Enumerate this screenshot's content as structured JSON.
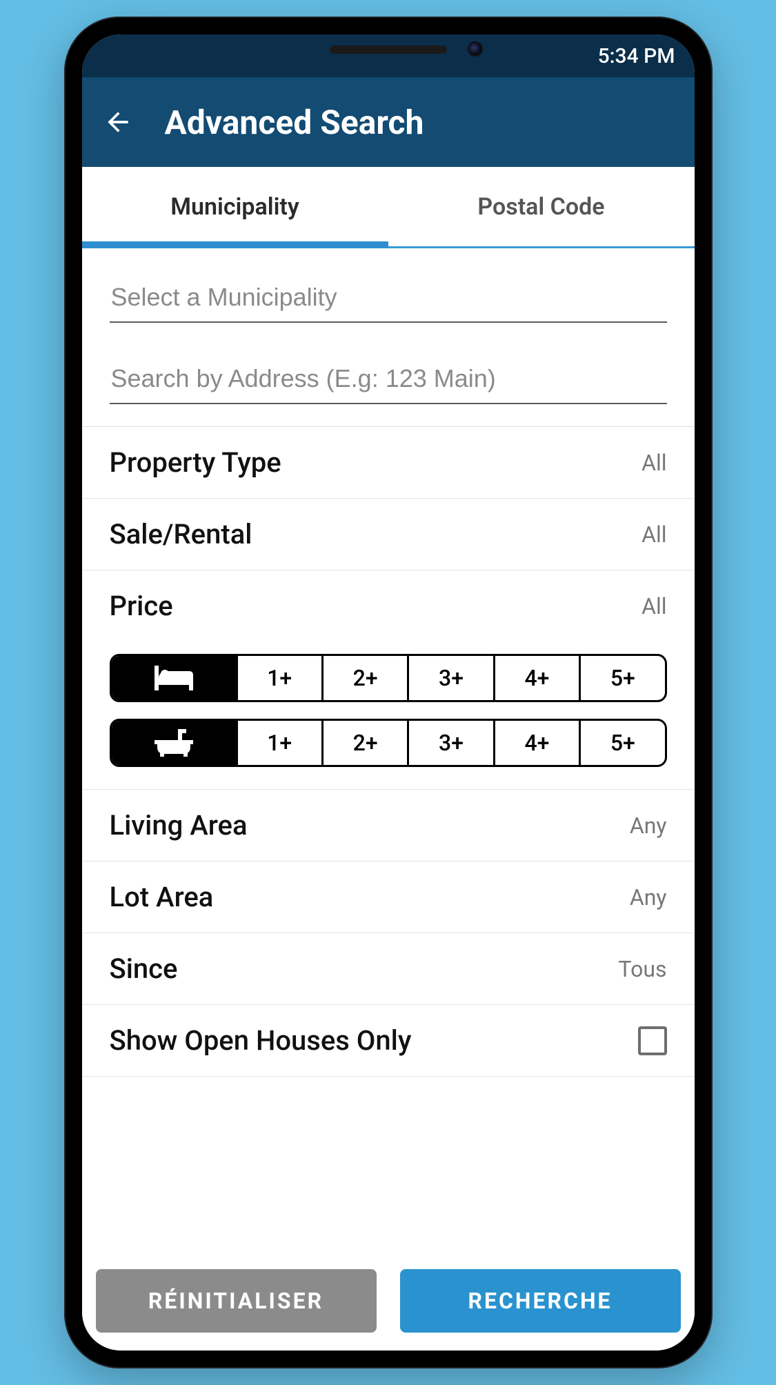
{
  "statusbar": {
    "time": "5:34 PM"
  },
  "appbar": {
    "title": "Advanced Search"
  },
  "tabs": {
    "municipality": "Municipality",
    "postal_code": "Postal Code"
  },
  "inputs": {
    "municipality_placeholder": "Select a Municipality",
    "address_placeholder": "Search by Address (E.g: 123 Main)"
  },
  "filters": {
    "property_type": {
      "label": "Property Type",
      "value": "All"
    },
    "sale_rental": {
      "label": "Sale/Rental",
      "value": "All"
    },
    "price": {
      "label": "Price",
      "value": "All"
    },
    "living_area": {
      "label": "Living Area",
      "value": "Any"
    },
    "lot_area": {
      "label": "Lot Area",
      "value": "Any"
    },
    "since": {
      "label": "Since",
      "value": "Tous"
    },
    "open_houses": {
      "label": "Show Open Houses Only"
    }
  },
  "segments": {
    "options": [
      "1+",
      "2+",
      "3+",
      "4+",
      "5+"
    ]
  },
  "footer": {
    "reset": "RÉINITIALISER",
    "search": "RECHERCHE"
  }
}
